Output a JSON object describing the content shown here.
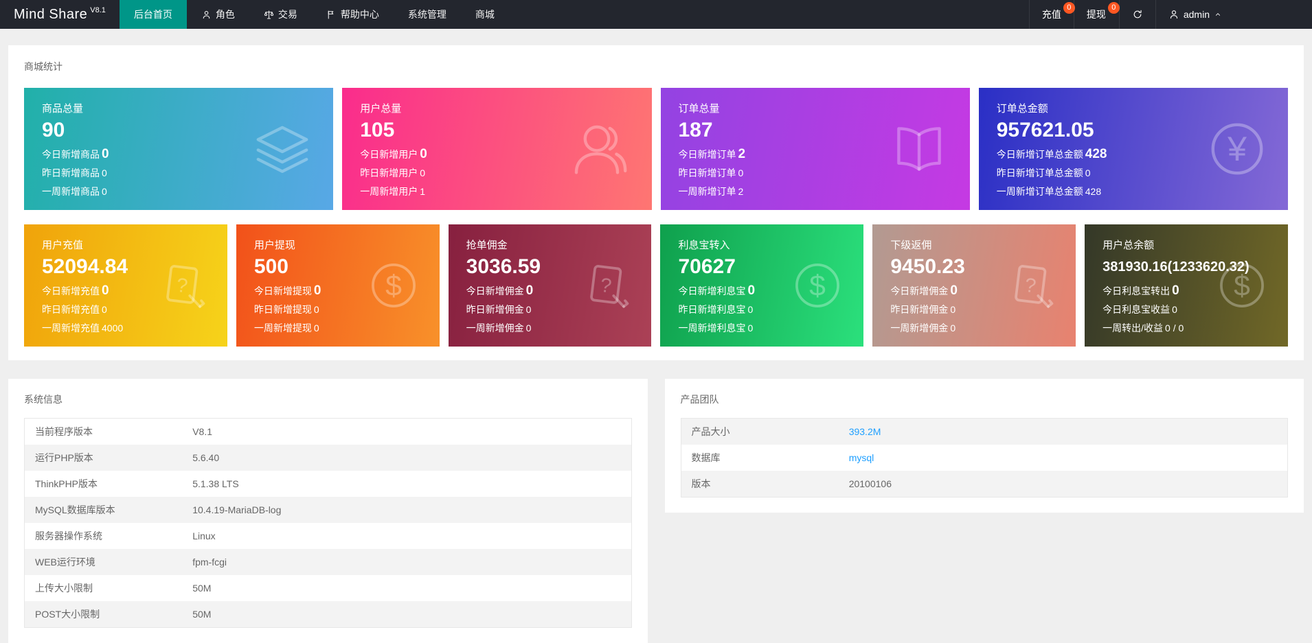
{
  "colors": {
    "navbar_bg": "#23262e",
    "accent_active_tab": "#009688",
    "badge": "#FF5722",
    "link": "#1E9FFF"
  },
  "navbar": {
    "logo": {
      "title": "Mind Share",
      "version": "V8.1"
    },
    "menu": [
      {
        "label": "后台首页",
        "icon": null,
        "active": true
      },
      {
        "label": "角色",
        "icon": "user-icon",
        "active": false
      },
      {
        "label": "交易",
        "icon": "scales-icon",
        "active": false
      },
      {
        "label": "帮助中心",
        "icon": "flag-icon",
        "active": false
      },
      {
        "label": "系统管理",
        "icon": null,
        "active": false
      },
      {
        "label": "商城",
        "icon": null,
        "active": false
      }
    ],
    "actions": [
      {
        "label": "充值",
        "badge": "0"
      },
      {
        "label": "提现",
        "badge": "0"
      }
    ],
    "refresh_icon": "refresh-icon",
    "user": {
      "icon": "user-icon",
      "name": "admin",
      "caret_icon": "chevron-up-icon"
    }
  },
  "stats_section": {
    "title": "商城统计",
    "row1": [
      {
        "title": "商品总量",
        "value": "90",
        "icon": "layers-icon",
        "gradient": [
          "#21b0a9",
          "#58a8e6"
        ],
        "lines": [
          {
            "label": "今日新增商品",
            "value": "0",
            "bold": true
          },
          {
            "label": "昨日新增商品",
            "value": "0",
            "bold": false
          },
          {
            "label": "一周新增商品",
            "value": "0",
            "bold": false
          }
        ]
      },
      {
        "title": "用户总量",
        "value": "105",
        "icon": "users-icon",
        "gradient": [
          "#fa2c8c",
          "#fe7672"
        ],
        "lines": [
          {
            "label": "今日新增用户",
            "value": "0",
            "bold": true
          },
          {
            "label": "昨日新增用户",
            "value": "0",
            "bold": false
          },
          {
            "label": "一周新增用户",
            "value": "1",
            "bold": false
          }
        ]
      },
      {
        "title": "订单总量",
        "value": "187",
        "icon": "book-icon",
        "gradient": [
          "#9343e2",
          "#c53ae3"
        ],
        "lines": [
          {
            "label": "今日新增订单",
            "value": "2",
            "bold": true
          },
          {
            "label": "昨日新增订单",
            "value": "0",
            "bold": false
          },
          {
            "label": "一周新增订单",
            "value": "2",
            "bold": false
          }
        ]
      },
      {
        "title": "订单总金额",
        "value": "957621.05",
        "icon": "yen-circle-icon",
        "gradient": [
          "#2a2fc5",
          "#8469d6"
        ],
        "lines": [
          {
            "label": "今日新增订单总金额",
            "value": "428",
            "bold": true
          },
          {
            "label": "昨日新增订单总金额",
            "value": "0",
            "bold": false
          },
          {
            "label": "一周新增订单总金额",
            "value": "428",
            "bold": false
          }
        ]
      }
    ],
    "row2": [
      {
        "title": "用户充值",
        "value": "52094.84",
        "icon": "doc-question-icon",
        "gradient": [
          "#f0a30b",
          "#f6d31a"
        ],
        "lines": [
          {
            "label": "今日新增充值",
            "value": "0",
            "bold": true
          },
          {
            "label": "昨日新增充值",
            "value": "0",
            "bold": false
          },
          {
            "label": "一周新增充值",
            "value": "4000",
            "bold": false
          }
        ]
      },
      {
        "title": "用户提现",
        "value": "500",
        "icon": "dollar-circle-icon",
        "gradient": [
          "#f2511a",
          "#f8912a"
        ],
        "lines": [
          {
            "label": "今日新增提现",
            "value": "0",
            "bold": true
          },
          {
            "label": "昨日新增提现",
            "value": "0",
            "bold": false
          },
          {
            "label": "一周新增提现",
            "value": "0",
            "bold": false
          }
        ]
      },
      {
        "title": "抢单佣金",
        "value": "3036.59",
        "icon": "doc-question-icon",
        "gradient": [
          "#87203f",
          "#ab4156"
        ],
        "lines": [
          {
            "label": "今日新增佣金",
            "value": "0",
            "bold": true
          },
          {
            "label": "昨日新增佣金",
            "value": "0",
            "bold": false
          },
          {
            "label": "一周新增佣金",
            "value": "0",
            "bold": false
          }
        ]
      },
      {
        "title": "利息宝转入",
        "value": "70627",
        "icon": "dollar-circle-icon",
        "gradient": [
          "#0fa04d",
          "#2be07c"
        ],
        "lines": [
          {
            "label": "今日新增利息宝",
            "value": "0",
            "bold": true
          },
          {
            "label": "昨日新增利息宝",
            "value": "0",
            "bold": false
          },
          {
            "label": "一周新增利息宝",
            "value": "0",
            "bold": false
          }
        ]
      },
      {
        "title": "下级返佣",
        "value": "9450.23",
        "icon": "doc-question-icon",
        "gradient": [
          "#b29a92",
          "#e8826f"
        ],
        "lines": [
          {
            "label": "今日新增佣金",
            "value": "0",
            "bold": true
          },
          {
            "label": "昨日新增佣金",
            "value": "0",
            "bold": false
          },
          {
            "label": "一周新增佣金",
            "value": "0",
            "bold": false
          }
        ]
      },
      {
        "title": "用户总余额",
        "value": "381930.16(1233620.32)",
        "icon": "dollar-circle-icon",
        "gradient": [
          "#343828",
          "#716827"
        ],
        "lines": [
          {
            "label": "今日利息宝转出",
            "value": "0",
            "bold": true
          },
          {
            "label": "今日利息宝收益",
            "value": "0",
            "bold": false
          },
          {
            "label": "一周转出/收益",
            "value": "0 / 0",
            "bold": false
          }
        ]
      }
    ]
  },
  "system_info": {
    "title": "系统信息",
    "rows": [
      {
        "label": "当前程序版本",
        "value": "V8.1",
        "link": false
      },
      {
        "label": "运行PHP版本",
        "value": "5.6.40",
        "link": false
      },
      {
        "label": "ThinkPHP版本",
        "value": "5.1.38 LTS",
        "link": false
      },
      {
        "label": "MySQL数据库版本",
        "value": "10.4.19-MariaDB-log",
        "link": false
      },
      {
        "label": "服务器操作系统",
        "value": "Linux",
        "link": false
      },
      {
        "label": "WEB运行环境",
        "value": "fpm-fcgi",
        "link": false
      },
      {
        "label": "上传大小限制",
        "value": "50M",
        "link": false
      },
      {
        "label": "POST大小限制",
        "value": "50M",
        "link": false
      }
    ]
  },
  "product_team": {
    "title": "产品团队",
    "rows": [
      {
        "label": "产品大小",
        "value": "393.2M",
        "link": true
      },
      {
        "label": "数据库",
        "value": "mysql",
        "link": true
      },
      {
        "label": "版本",
        "value": "20100106",
        "link": false
      }
    ]
  }
}
